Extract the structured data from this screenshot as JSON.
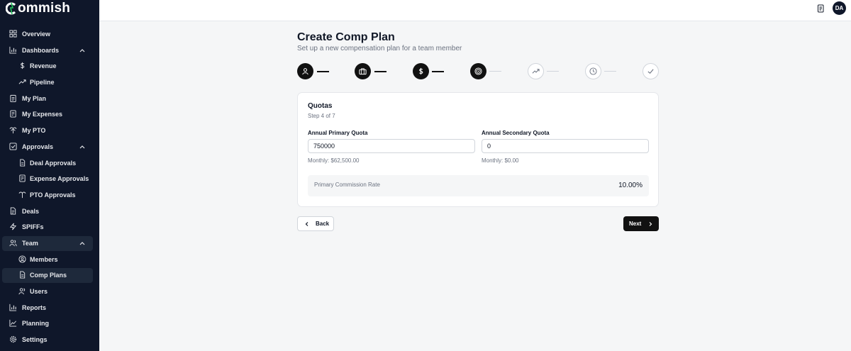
{
  "app": {
    "name": "ommish",
    "brand_color": "#0f172a"
  },
  "sidebar": {
    "items": [
      {
        "label": "Overview",
        "icon": "layout-grid-icon"
      },
      {
        "label": "Dashboards",
        "icon": "bar-chart-icon",
        "expanded": true
      },
      {
        "label": "Revenue",
        "icon": "dollar-icon"
      },
      {
        "label": "Pipeline",
        "icon": "trending-up-icon"
      },
      {
        "label": "My Plan",
        "icon": "clipboard-icon"
      },
      {
        "label": "My Expenses",
        "icon": "receipt-icon"
      },
      {
        "label": "My PTO",
        "icon": "palm-tree-icon"
      },
      {
        "label": "Approvals",
        "icon": "check-square-icon",
        "expanded": true
      },
      {
        "label": "Deal Approvals",
        "icon": "file-icon"
      },
      {
        "label": "Expense Approvals",
        "icon": "receipt-icon"
      },
      {
        "label": "PTO Approvals",
        "icon": "palm-tree-icon"
      },
      {
        "label": "Deals",
        "icon": "file-text-icon"
      },
      {
        "label": "SPIFFs",
        "icon": "zap-icon"
      },
      {
        "label": "Team",
        "icon": "users-icon",
        "expanded": true
      },
      {
        "label": "Members",
        "icon": "user-circle-icon"
      },
      {
        "label": "Comp Plans",
        "icon": "file-icon",
        "active": true
      },
      {
        "label": "Users",
        "icon": "users-icon"
      },
      {
        "label": "Reports",
        "icon": "bar-chart-icon"
      },
      {
        "label": "Planning",
        "icon": "line-chart-icon"
      },
      {
        "label": "Settings",
        "icon": "gear-icon"
      }
    ]
  },
  "header": {
    "avatar_initials": "DA"
  },
  "main": {
    "title": "Create Comp Plan",
    "subtitle": "Set up a new compensation plan for a team member",
    "steps": [
      {
        "icon": "user-icon",
        "state": "done"
      },
      {
        "icon": "briefcase-icon",
        "state": "done"
      },
      {
        "icon": "dollar-icon",
        "state": "done"
      },
      {
        "icon": "target-icon",
        "state": "current"
      },
      {
        "icon": "trending-up-icon",
        "state": "todo"
      },
      {
        "icon": "clock-icon",
        "state": "todo"
      },
      {
        "icon": "check-icon",
        "state": "todo"
      }
    ],
    "card": {
      "title": "Quotas",
      "step_text": "Step 4 of 7",
      "primary_label": "Annual Primary Quota",
      "primary_value": "750000",
      "primary_hint": "Monthly: $62,500.00",
      "secondary_label": "Annual Secondary Quota",
      "secondary_value": "0",
      "secondary_hint": "Monthly: $0.00",
      "rate_label": "Primary Commission Rate",
      "rate_value": "10.00%"
    },
    "back_label": "Back",
    "next_label": "Next"
  }
}
